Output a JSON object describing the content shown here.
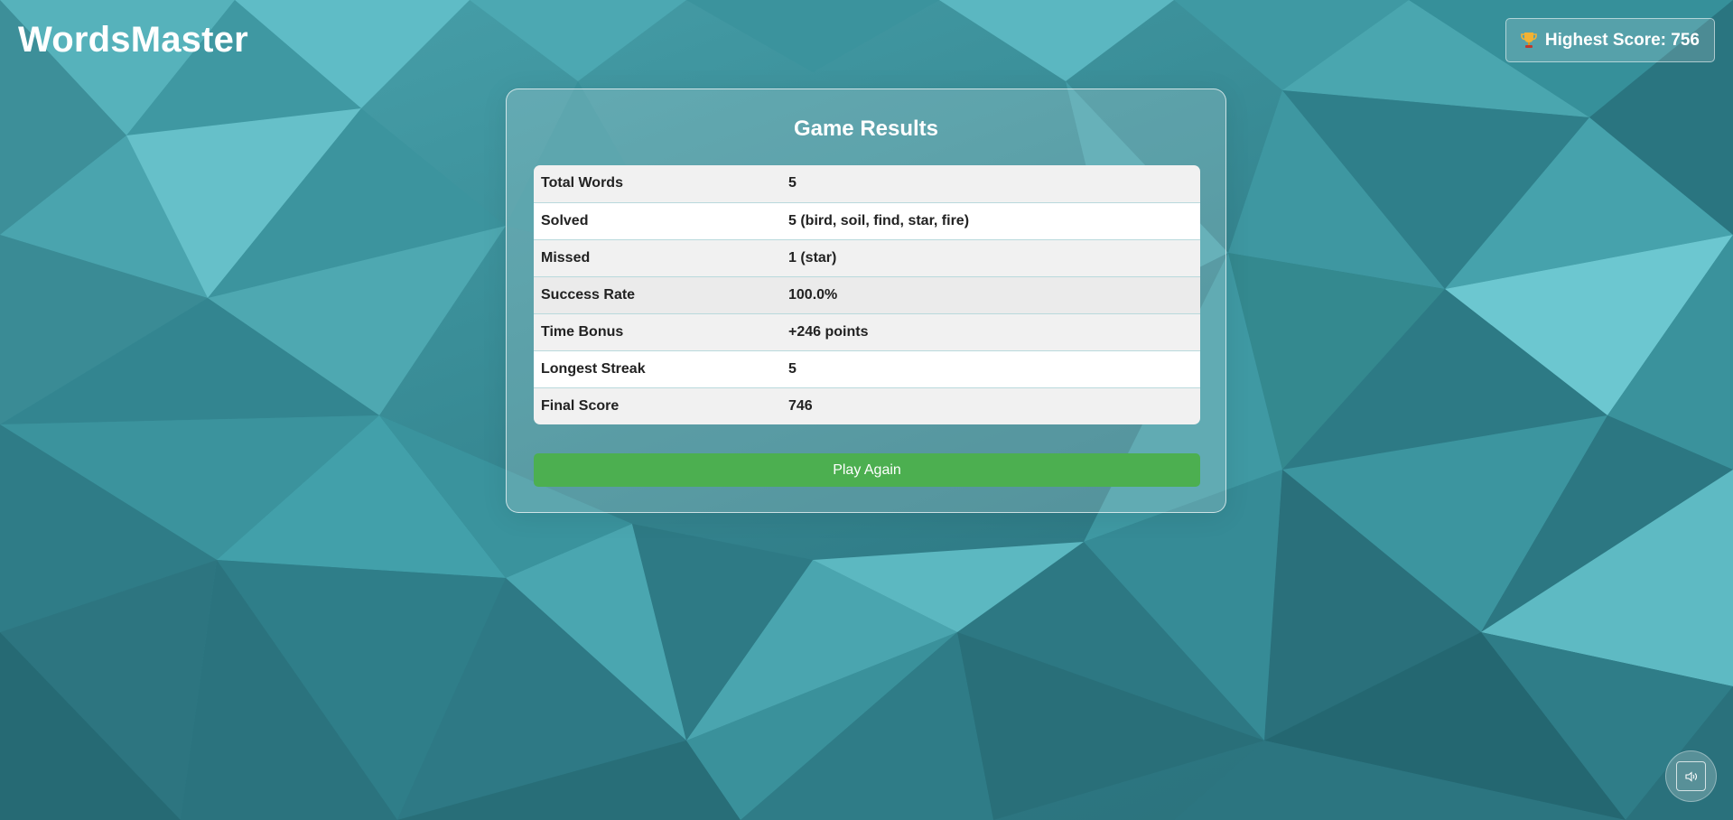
{
  "app": {
    "title": "WordsMaster"
  },
  "header": {
    "highest_score_label": "Highest Score: 756",
    "trophy_icon": "trophy-icon"
  },
  "results": {
    "title": "Game Results",
    "rows": [
      {
        "label": "Total Words",
        "value": "5"
      },
      {
        "label": "Solved",
        "value": "5 (bird, soil, find, star, fire)"
      },
      {
        "label": "Missed",
        "value": "1 (star)"
      },
      {
        "label": "Success Rate",
        "value": "100.0%"
      },
      {
        "label": "Time Bonus",
        "value": "+246 points"
      },
      {
        "label": "Longest Streak",
        "value": "5"
      },
      {
        "label": "Final Score",
        "value": "746"
      }
    ],
    "play_again_label": "Play Again"
  },
  "controls": {
    "sound_icon": "speaker-icon"
  },
  "colors": {
    "accent_green": "#4caf50",
    "background_teal": "#3a8e98"
  }
}
